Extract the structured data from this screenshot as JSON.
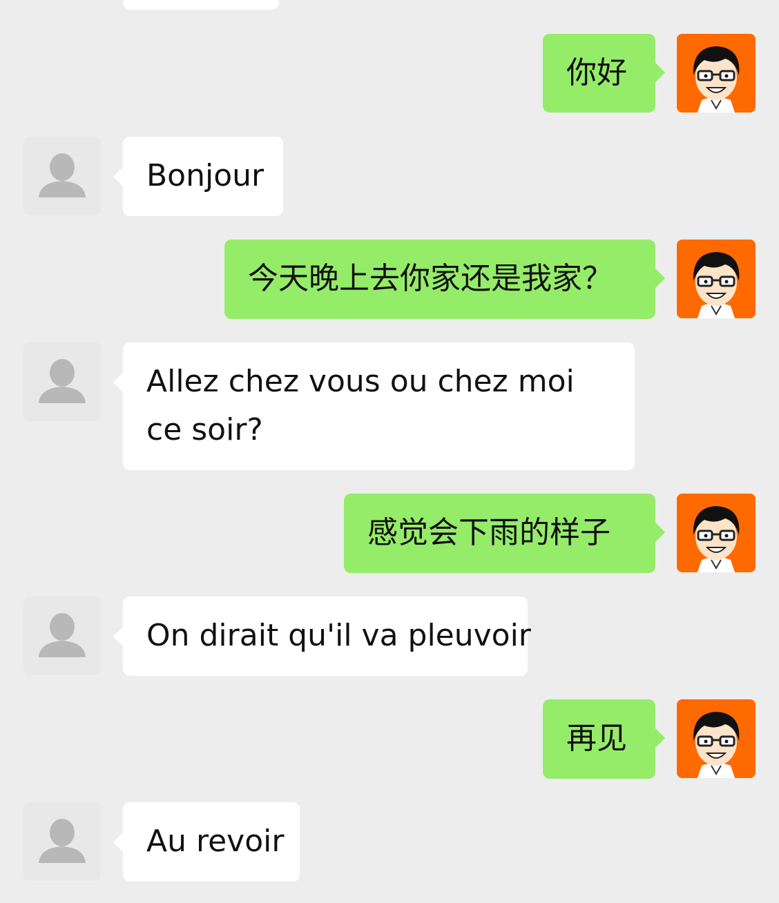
{
  "chat": {
    "messages": [
      {
        "side": "out",
        "text": "你好"
      },
      {
        "side": "in",
        "text": "Bonjour"
      },
      {
        "side": "out",
        "text": "今天晚上去你家还是我家？"
      },
      {
        "side": "in",
        "text": "Allez chez vous ou chez moi ce soir?"
      },
      {
        "side": "out",
        "text": "感觉会下雨的样子"
      },
      {
        "side": "in",
        "text": "On dirait qu'il va pleuvoir"
      },
      {
        "side": "out",
        "text": "再见"
      },
      {
        "side": "in",
        "text": "Au revoir"
      }
    ]
  },
  "avatars": {
    "contact_icon": "person-silhouette-icon",
    "me_icon": "cartoon-boy-with-glasses-icon",
    "me_bg_color": "#ff6a00"
  },
  "colors": {
    "background": "#ededed",
    "incoming_bubble": "#ffffff",
    "outgoing_bubble": "#95ec69"
  }
}
